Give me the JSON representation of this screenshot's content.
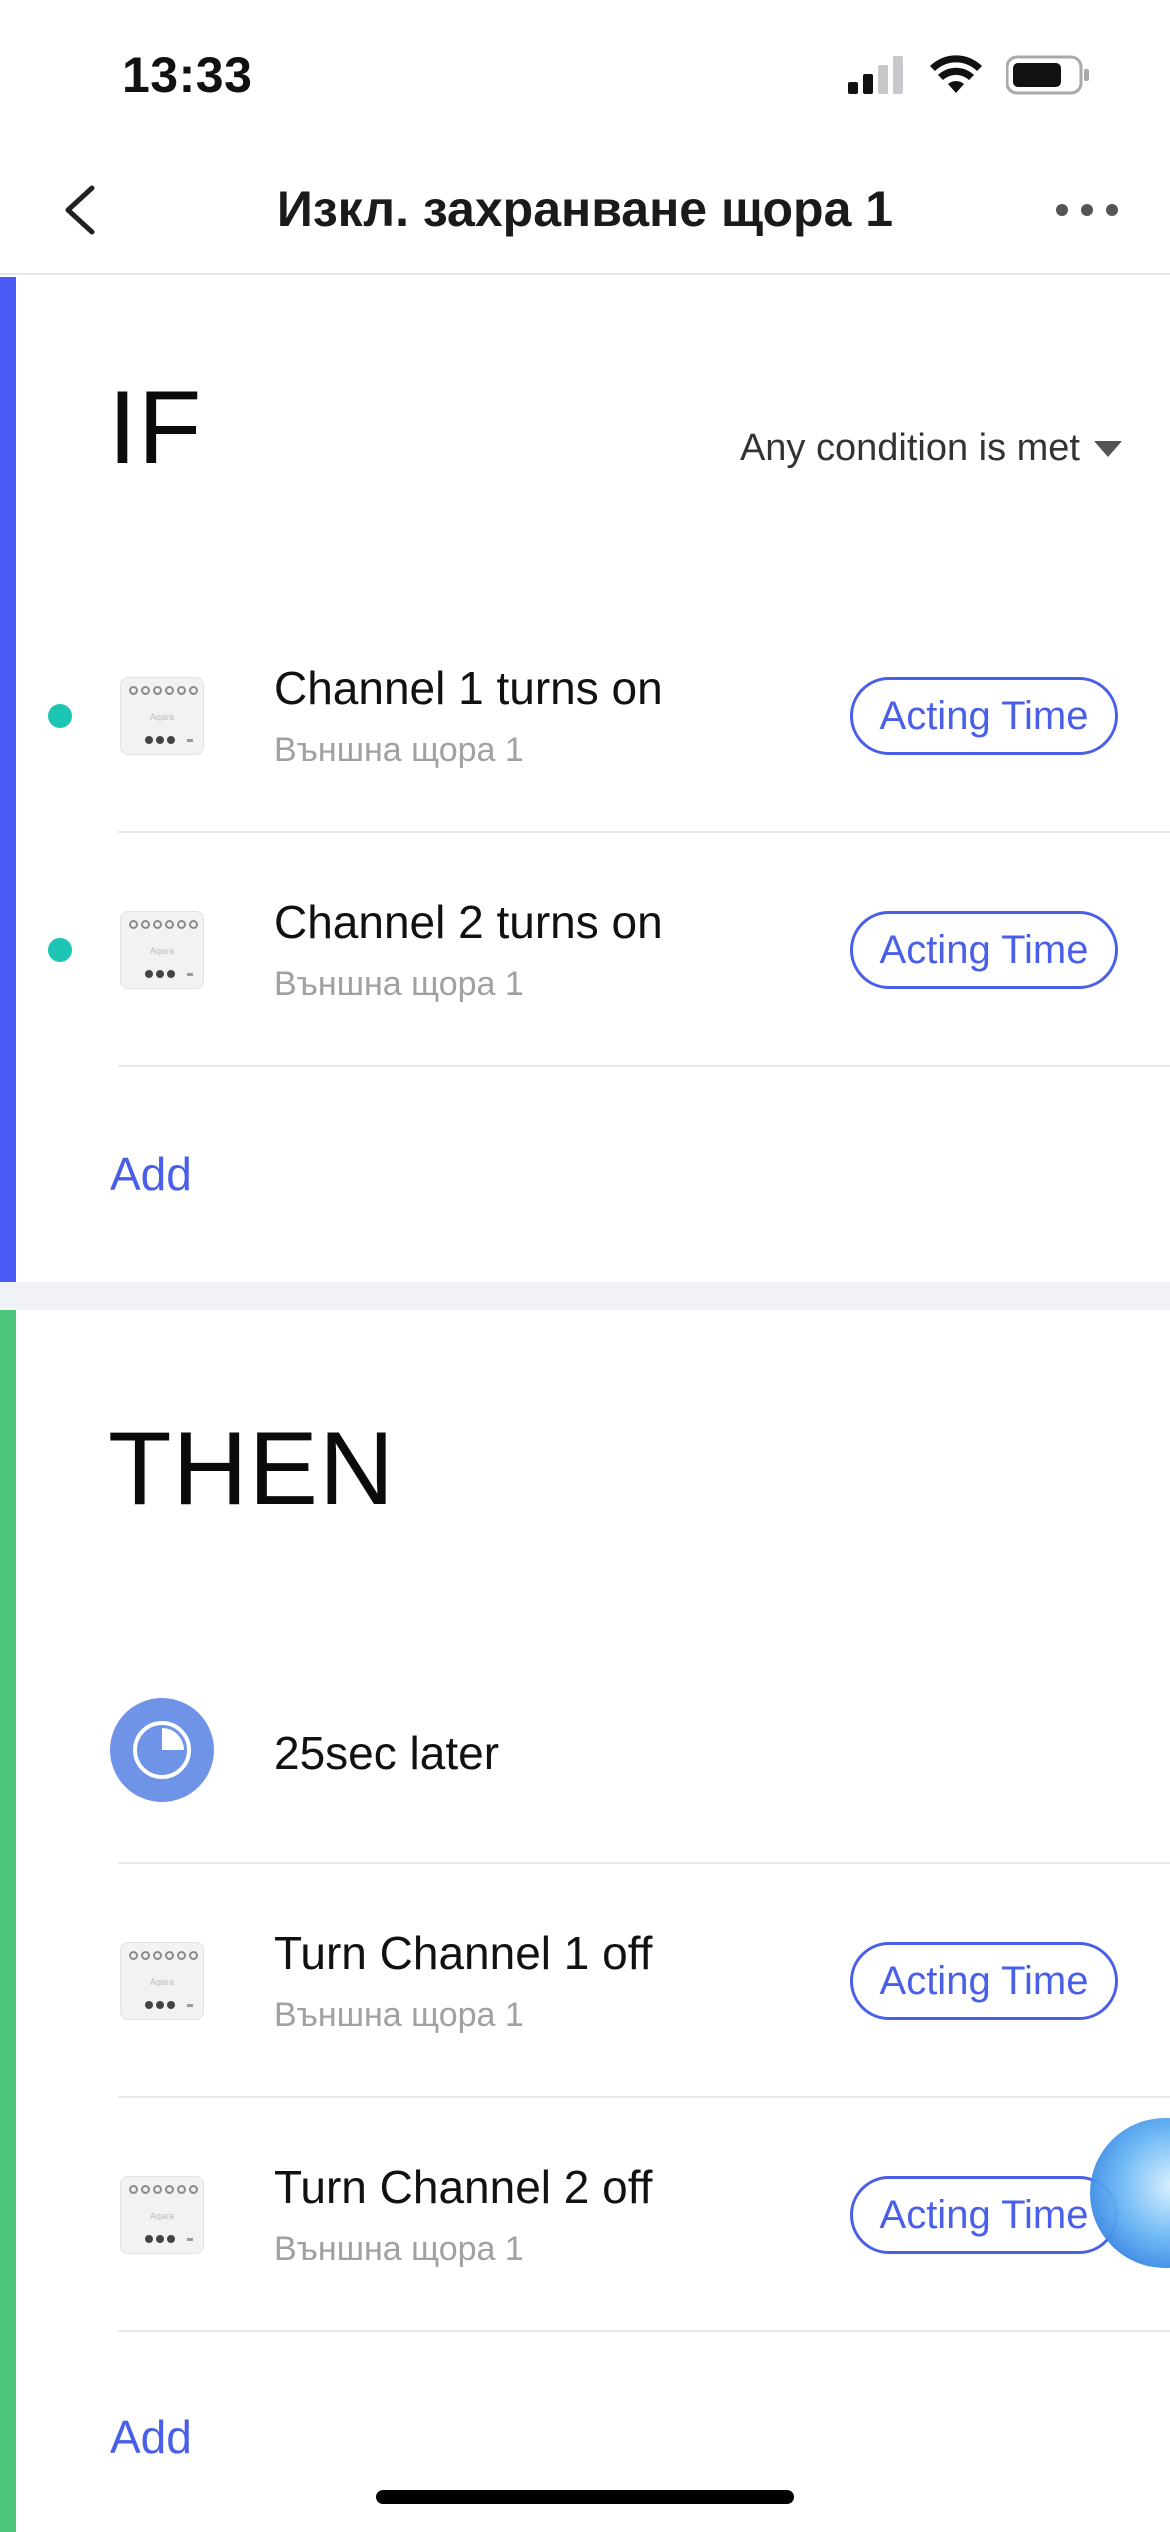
{
  "status_bar": {
    "time": "13:33"
  },
  "nav": {
    "title": "Изкл. захранване щора 1"
  },
  "if_section": {
    "heading": "IF",
    "condition_mode": "Any condition is met",
    "rows": [
      {
        "title": "Channel 1 turns on",
        "subtitle": "Външна щора 1",
        "action": "Acting Time"
      },
      {
        "title": "Channel 2 turns on",
        "subtitle": "Външна щора 1",
        "action": "Acting Time"
      }
    ],
    "add_label": "Add"
  },
  "then_section": {
    "heading": "THEN",
    "delay": {
      "label": "25sec later"
    },
    "rows": [
      {
        "title": "Turn Channel 1 off",
        "subtitle": "Външна щора 1",
        "action": "Acting Time"
      },
      {
        "title": "Turn Channel 2 off",
        "subtitle": "Външна щора 1",
        "action": "Acting Time"
      }
    ],
    "add_label": "Add"
  },
  "colors": {
    "if_accent": "#4a5cf6",
    "then_accent": "#4cc47c",
    "link": "#4a5fe8",
    "dot": "#1cc4b3",
    "timer": "#6f93e6"
  }
}
